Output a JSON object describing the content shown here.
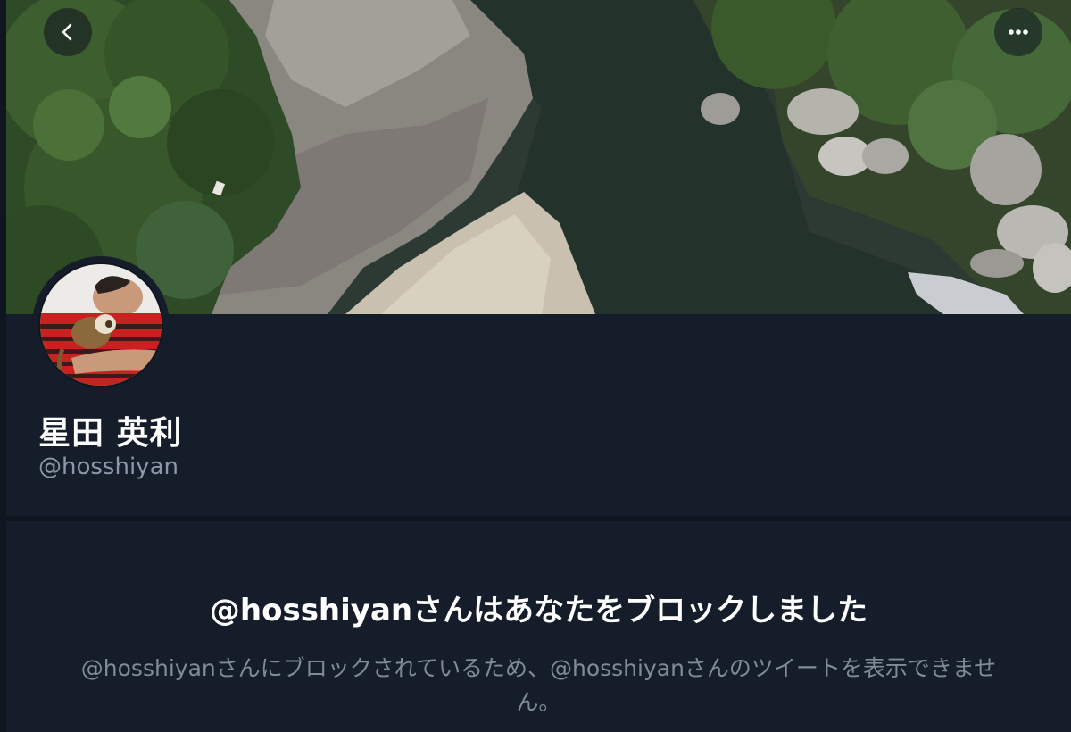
{
  "header": {
    "back_icon": "chevron-left-icon",
    "more_icon": "more-horizontal-icon",
    "banner_description": "river-landscape-banner"
  },
  "profile": {
    "display_name": "星田 英利",
    "handle": "@hosshiyan",
    "avatar": "profile-avatar"
  },
  "blocked_notice": {
    "title": "@hosshiyanさんはあなたをブロックしました",
    "description": "@hosshiyanさんにブロックされているため、@hosshiyanさんのツイートを表示できません。"
  },
  "colors": {
    "background": "#151d2a",
    "text_primary": "#ffffff",
    "text_secondary": "#8b98a5"
  }
}
